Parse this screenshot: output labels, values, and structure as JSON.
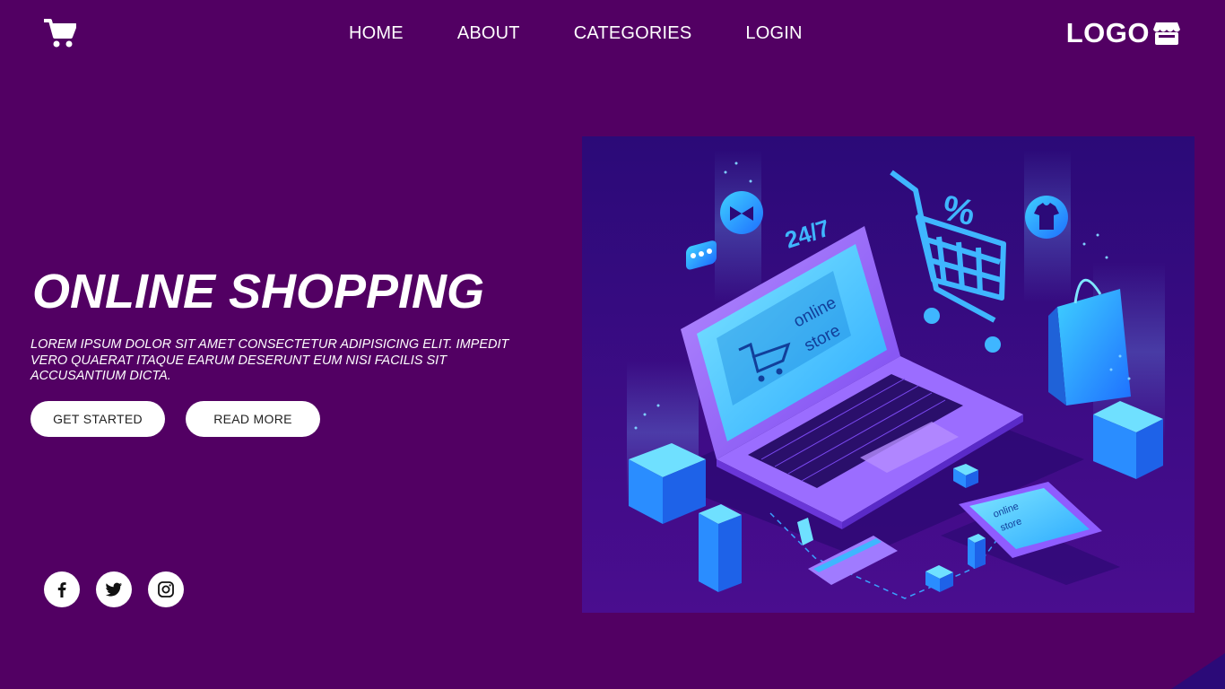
{
  "header": {
    "nav": [
      "HOME",
      "ABOUT",
      "CATEGORIES",
      "LOGIN"
    ],
    "logo": "LOGO"
  },
  "hero": {
    "title": "ONLINE SHOPPING",
    "description": "LOREM IPSUM DOLOR SIT AMET CONSECTETUR ADIPISICING ELIT. IMPEDIT VERO QUAERAT ITAQUE EARUM DESERUNT EUM NISI FACILIS SIT ACCUSANTIUM DICTA.",
    "buttons": {
      "get_started": "GET STARTED",
      "read_more": "READ MORE"
    }
  },
  "illustration": {
    "badge_24_7": "24/7",
    "percent": "%",
    "laptop_screen": [
      "online",
      "store"
    ],
    "phone_screen": [
      "online",
      "store"
    ]
  },
  "icons": {
    "cart": "shopping-cart-icon",
    "store": "store-icon",
    "socials": [
      "facebook-icon",
      "twitter-icon",
      "instagram-icon"
    ]
  },
  "colors": {
    "background": "#520063",
    "illustration_bg": "#3a0f86",
    "accent_blue": "#1fa3ff",
    "accent_purple": "#8f5cff",
    "button_bg": "#ffffff"
  }
}
